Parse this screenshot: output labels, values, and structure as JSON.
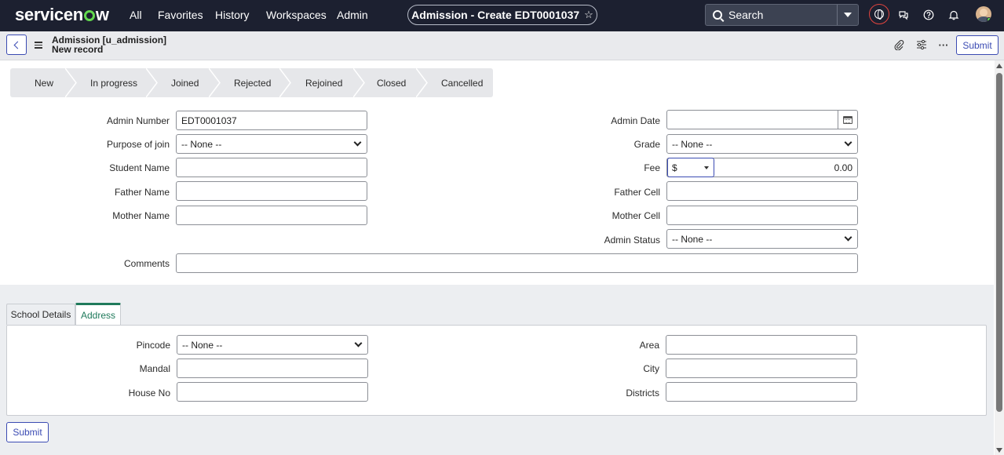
{
  "topbar": {
    "logo_text_a": "servicen",
    "logo_text_b": "w",
    "nav": [
      "All",
      "Favorites",
      "History",
      "Workspaces",
      "Admin"
    ],
    "context_title": "Admission - Create EDT0001037",
    "star_icon": "☆",
    "search_placeholder": "Search",
    "icons": [
      "globe-icon",
      "chat-icon",
      "help-icon",
      "bell-icon",
      "user-avatar"
    ]
  },
  "header": {
    "title_line1": "Admission [u_admission]",
    "title_line2": "New record",
    "submit_label": "Submit",
    "more_icon": "···"
  },
  "process_flow": {
    "stages": [
      "New",
      "In progress",
      "Joined",
      "Rejected",
      "Rejoined",
      "Closed",
      "Cancelled"
    ]
  },
  "form": {
    "left": [
      {
        "label": "Admin Number",
        "value": "EDT0001037",
        "type": "text"
      },
      {
        "label": "Purpose of join",
        "value": "-- None --",
        "type": "select"
      },
      {
        "label": "Student Name",
        "value": "",
        "type": "text"
      },
      {
        "label": "Father Name",
        "value": "",
        "type": "text"
      },
      {
        "label": "Mother Name",
        "value": "",
        "type": "text"
      }
    ],
    "right": [
      {
        "label": "Admin Date",
        "value": "",
        "type": "date"
      },
      {
        "label": "Grade",
        "value": "-- None --",
        "type": "select"
      },
      {
        "label": "Fee",
        "currency": "$",
        "value": "0.00",
        "type": "currency"
      },
      {
        "label": "Father Cell",
        "value": "",
        "type": "text"
      },
      {
        "label": "Mother Cell",
        "value": "",
        "type": "text"
      },
      {
        "label": "Admin Status",
        "value": "-- None --",
        "type": "select"
      }
    ],
    "comments": {
      "label": "Comments",
      "value": ""
    }
  },
  "tabs": {
    "items": [
      "School Details",
      "Address"
    ],
    "active": "Address"
  },
  "address": {
    "left": [
      {
        "label": "Pincode",
        "value": "-- None --",
        "type": "select"
      },
      {
        "label": "Mandal",
        "value": "",
        "type": "text"
      },
      {
        "label": "House No",
        "value": "",
        "type": "text"
      }
    ],
    "right": [
      {
        "label": "Area",
        "value": "",
        "type": "text"
      },
      {
        "label": "City",
        "value": "",
        "type": "text"
      },
      {
        "label": "Districts",
        "value": "",
        "type": "text"
      }
    ]
  },
  "footer": {
    "submit_label": "Submit"
  },
  "colors": {
    "topbar": "#1c2030",
    "accent": "#3b4bb3",
    "tab_active": "#1f7a5b",
    "logo_green": "#62d84e"
  }
}
